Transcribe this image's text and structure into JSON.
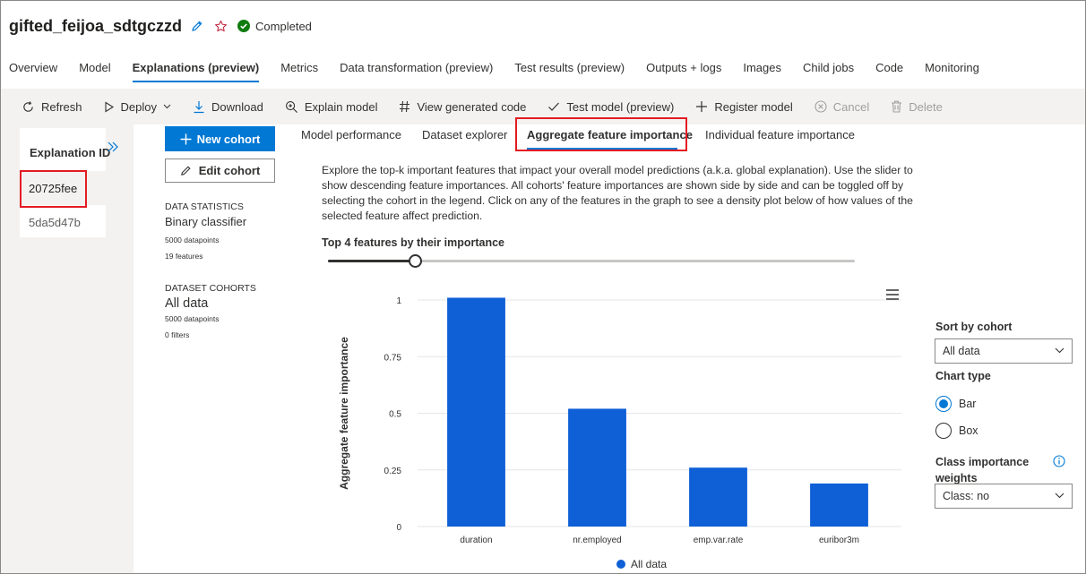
{
  "header": {
    "run_name": "gifted_feijoa_sdtgczzd",
    "status": "Completed",
    "colors": {
      "status_green": "#107c10",
      "star_red": "#c4314b",
      "accent": "#0078d4"
    }
  },
  "tabs": [
    {
      "label": "Overview",
      "active": false
    },
    {
      "label": "Model",
      "active": false
    },
    {
      "label": "Explanations (preview)",
      "active": true
    },
    {
      "label": "Metrics",
      "active": false
    },
    {
      "label": "Data transformation (preview)",
      "active": false
    },
    {
      "label": "Test results (preview)",
      "active": false
    },
    {
      "label": "Outputs + logs",
      "active": false
    },
    {
      "label": "Images",
      "active": false
    },
    {
      "label": "Child jobs",
      "active": false
    },
    {
      "label": "Code",
      "active": false
    },
    {
      "label": "Monitoring",
      "active": false
    }
  ],
  "toolbar": {
    "refresh": "Refresh",
    "deploy": "Deploy",
    "download": "Download",
    "explain_model": "Explain model",
    "view_generated_code": "View generated code",
    "test_model": "Test model (preview)",
    "register_model": "Register model",
    "cancel": "Cancel",
    "delete": "Delete"
  },
  "explanations": {
    "header": "Explanation ID",
    "items": [
      {
        "id": "20725fee",
        "selected": true
      },
      {
        "id": "5da5d47b",
        "selected": false
      }
    ]
  },
  "cohort_panel": {
    "new_cohort": "New cohort",
    "edit_cohort": "Edit cohort",
    "data_statistics_label": "DATA STATISTICS",
    "classifier_type": "Binary classifier",
    "datapoints": "5000 datapoints",
    "features": "19 features",
    "dataset_cohorts_label": "DATASET COHORTS",
    "cohort_name": "All data",
    "cohort_datapoints": "5000 datapoints",
    "cohort_filters": "0 filters"
  },
  "subtabs": [
    {
      "label": "Model performance",
      "active": false
    },
    {
      "label": "Dataset explorer",
      "active": false
    },
    {
      "label": "Aggregate feature importance",
      "active": true
    },
    {
      "label": "Individual feature importance",
      "active": false
    }
  ],
  "description": "Explore the top-k important features that impact your overall model predictions (a.k.a. global explanation). Use the slider to show descending feature importances. All cohorts' feature importances are shown side by side and can be toggled off by selecting the cohort in the legend. Click on any of the features in the graph to see a density plot below of how values of the selected feature affect prediction.",
  "top_k": {
    "label": "Top 4 features by their importance",
    "value": 4,
    "fraction": 0.165
  },
  "chart_data": {
    "type": "bar",
    "categories": [
      "duration",
      "nr.employed",
      "emp.var.rate",
      "euribor3m"
    ],
    "series": [
      {
        "name": "All data",
        "values": [
          1.01,
          0.52,
          0.26,
          0.19
        ],
        "color": "#0f5fd6"
      }
    ],
    "ylabel": "Aggregate feature importance",
    "xlabel": "",
    "ylim": [
      0,
      1
    ],
    "yticks": [
      0,
      0.25,
      0.5,
      0.75,
      1
    ],
    "ytick_labels": [
      "0",
      "0.25",
      "0.5",
      "0.75",
      "1"
    ],
    "grid": true,
    "legend_position": "bottom-center"
  },
  "settings": {
    "sort_by_label": "Sort by cohort",
    "sort_by_value": "All data",
    "chart_type_label": "Chart type",
    "chart_type_options": [
      {
        "label": "Bar",
        "checked": true
      },
      {
        "label": "Box",
        "checked": false
      }
    ],
    "class_importance_label": "Class importance weights",
    "class_value": "Class: no"
  }
}
